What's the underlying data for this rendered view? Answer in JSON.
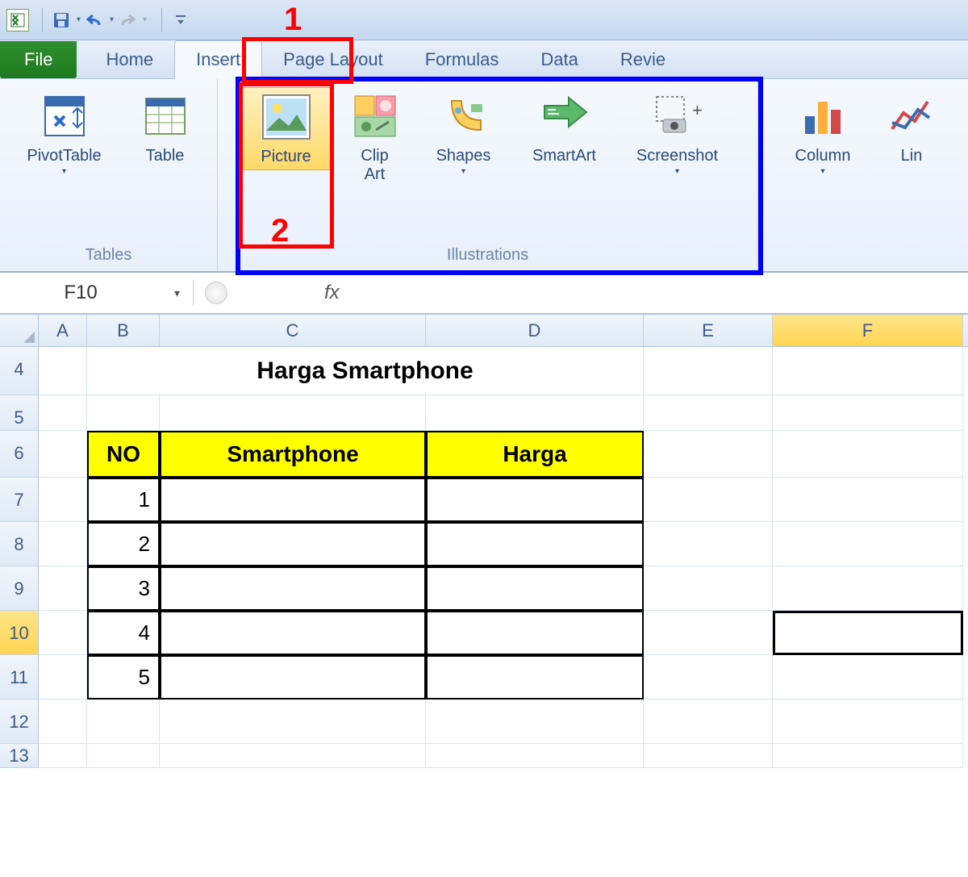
{
  "tabs": {
    "file": "File",
    "home": "Home",
    "insert": "Insert",
    "page_layout": "Page Layout",
    "formulas": "Formulas",
    "data": "Data",
    "review": "Revie"
  },
  "ribbon": {
    "tables": {
      "label": "Tables",
      "pivot": "PivotTable",
      "table": "Table"
    },
    "illustrations": {
      "label": "Illustrations",
      "picture": "Picture",
      "clipart": "Clip\nArt",
      "shapes": "Shapes",
      "smartart": "SmartArt",
      "screenshot": "Screenshot"
    },
    "charts": {
      "column": "Column",
      "line": "Lin"
    }
  },
  "formula_bar": {
    "namebox": "F10",
    "fx": "fx",
    "formula": ""
  },
  "columns": [
    "A",
    "B",
    "C",
    "D",
    "E",
    "F"
  ],
  "rows": [
    "4",
    "5",
    "6",
    "7",
    "8",
    "9",
    "10",
    "11",
    "12",
    "13"
  ],
  "sheet": {
    "title": "Harga Smartphone",
    "headers": {
      "no": "NO",
      "smartphone": "Smartphone",
      "harga": "Harga"
    },
    "data": [
      {
        "no": "1",
        "smartphone": "",
        "harga": ""
      },
      {
        "no": "2",
        "smartphone": "",
        "harga": ""
      },
      {
        "no": "3",
        "smartphone": "",
        "harga": ""
      },
      {
        "no": "4",
        "smartphone": "",
        "harga": ""
      },
      {
        "no": "5",
        "smartphone": "",
        "harga": ""
      }
    ]
  },
  "annotations": {
    "n1": "1",
    "n2": "2"
  }
}
